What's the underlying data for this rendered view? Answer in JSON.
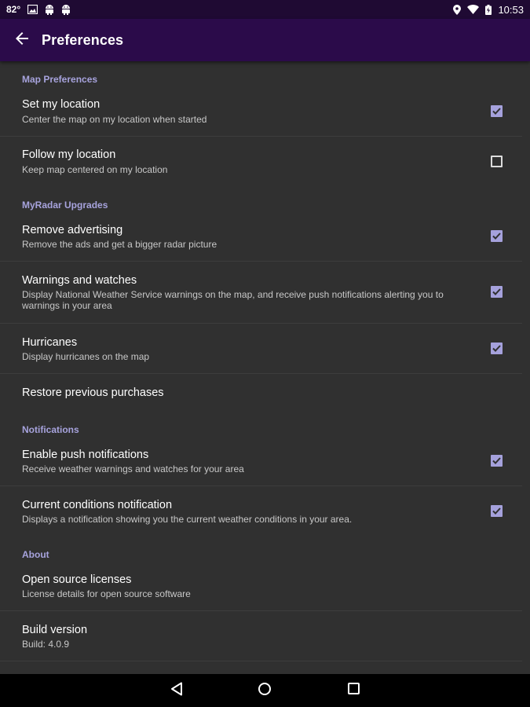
{
  "status_bar": {
    "temperature": "82°",
    "time": "10:53",
    "left_icons": [
      "image-icon",
      "android-icon",
      "android-icon"
    ],
    "right_icons": [
      "location-icon",
      "wifi-icon",
      "battery-icon"
    ]
  },
  "app_bar": {
    "title": "Preferences",
    "back_icon": "arrow-back-icon"
  },
  "sections": {
    "map_preferences": {
      "header": "Map Preferences"
    },
    "myradar_upgrades": {
      "header": "MyRadar Upgrades"
    },
    "notifications": {
      "header": "Notifications"
    },
    "about": {
      "header": "About"
    }
  },
  "prefs": {
    "set_location": {
      "title": "Set my location",
      "summary": "Center the map on my location when started",
      "checked": true
    },
    "follow_location": {
      "title": "Follow my location",
      "summary": "Keep map centered on my location",
      "checked": false
    },
    "remove_ads": {
      "title": "Remove advertising",
      "summary": "Remove the ads and get a bigger radar picture",
      "checked": true
    },
    "warnings": {
      "title": "Warnings and watches",
      "summary_line1": "Display National Weather Service warnings on the map, and receive push notifications alerting you to",
      "summary_line2": "warnings in your area",
      "checked": true
    },
    "hurricanes": {
      "title": "Hurricanes",
      "summary": "Display hurricanes on the map",
      "checked": true
    },
    "restore_purchases": {
      "title": "Restore previous purchases"
    },
    "push_notifications": {
      "title": "Enable push notifications",
      "summary": "Receive weather warnings and watches for your area",
      "checked": true
    },
    "current_conditions": {
      "title": "Current conditions notification",
      "summary": "Displays a notification showing you the current weather conditions in your area.",
      "checked": true
    },
    "open_source": {
      "title": "Open source licenses",
      "summary": "License details for open source software"
    },
    "build_version": {
      "title": "Build version",
      "summary": "Build: 4.0.9"
    }
  },
  "colors": {
    "status_bar": "#1f0a33",
    "app_bar": "#2b0b4a",
    "background": "#303030",
    "accent": "#a5a1dc",
    "section_header": "#a7a3dd"
  },
  "nav_bar": {
    "back_icon": "nav-back-icon",
    "home_icon": "nav-home-icon",
    "recents_icon": "nav-recents-icon"
  }
}
